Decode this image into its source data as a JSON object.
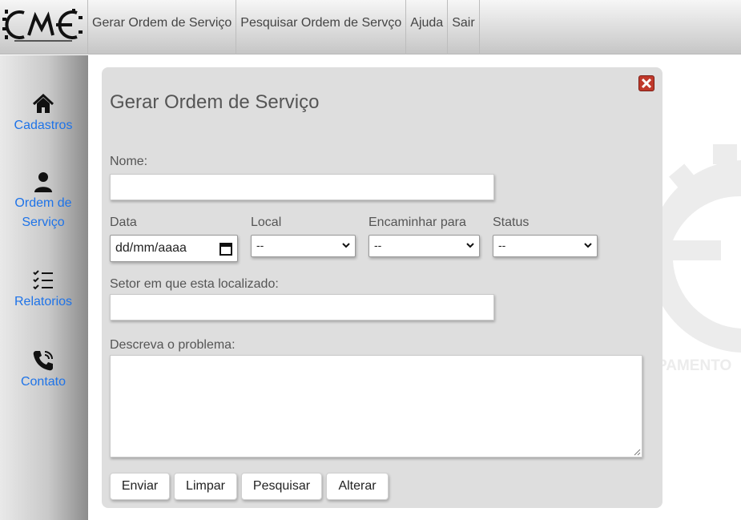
{
  "nav": {
    "items": [
      "Gerar Ordem de Serviço",
      "Pesquisar Ordem de Servço",
      "Ajuda",
      "Sair"
    ]
  },
  "sidebar": {
    "items": [
      {
        "label": "Cadastros",
        "icon": "home-icon"
      },
      {
        "label": "Ordem de Serviço",
        "icon": "user-icon"
      },
      {
        "label": "Relatorios",
        "icon": "checklist-icon"
      },
      {
        "label": "Contato",
        "icon": "phone-icon"
      }
    ]
  },
  "watermark": {
    "text": "PAMENTO"
  },
  "form": {
    "title": "Gerar Ordem de Serviço",
    "nome_label": "Nome:",
    "data_label": "Data",
    "data_placeholder": "dd/mm/aaaa",
    "local_label": "Local",
    "local_value": "--",
    "encaminhar_label": "Encaminhar para",
    "encaminhar_value": "--",
    "status_label": "Status",
    "status_value": "--",
    "setor_label": "Setor em que esta localizado:",
    "problema_label": "Descreva o problema:"
  },
  "buttons": {
    "enviar": "Enviar",
    "limpar": "Limpar",
    "pesquisar": "Pesquisar",
    "alterar": "Alterar"
  },
  "colors": {
    "link": "#1e73e8",
    "close": "#c0392b"
  }
}
